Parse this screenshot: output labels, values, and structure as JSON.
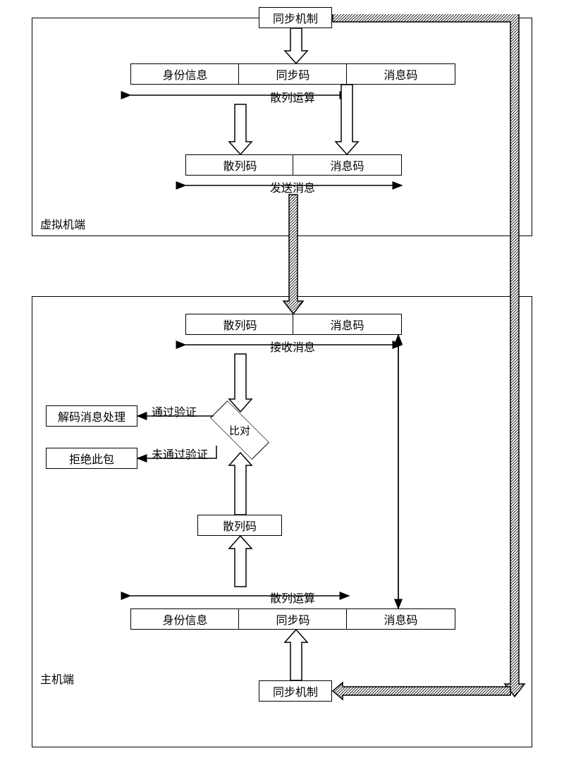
{
  "vm": {
    "sync_mechanism": "同步机制",
    "identity_info": "身份信息",
    "sync_code": "同步码",
    "message_code": "消息码",
    "hash_op": "散列运算",
    "hash_code": "散列码",
    "send_message": "发送消息",
    "side_label": "虚拟机端"
  },
  "host": {
    "hash_code": "散列码",
    "message_code": "消息码",
    "receive_message": "接收消息",
    "decode_msg_process": "解码消息处理",
    "reject_packet": "拒绝此包",
    "compare": "比对",
    "pass_verify": "通过验证",
    "fail_verify": "未通过验证",
    "hash_code2": "散列码",
    "hash_op": "散列运算",
    "identity_info": "身份信息",
    "sync_code": "同步码",
    "message_code2": "消息码",
    "sync_mechanism": "同步机制",
    "side_label": "主机端"
  }
}
